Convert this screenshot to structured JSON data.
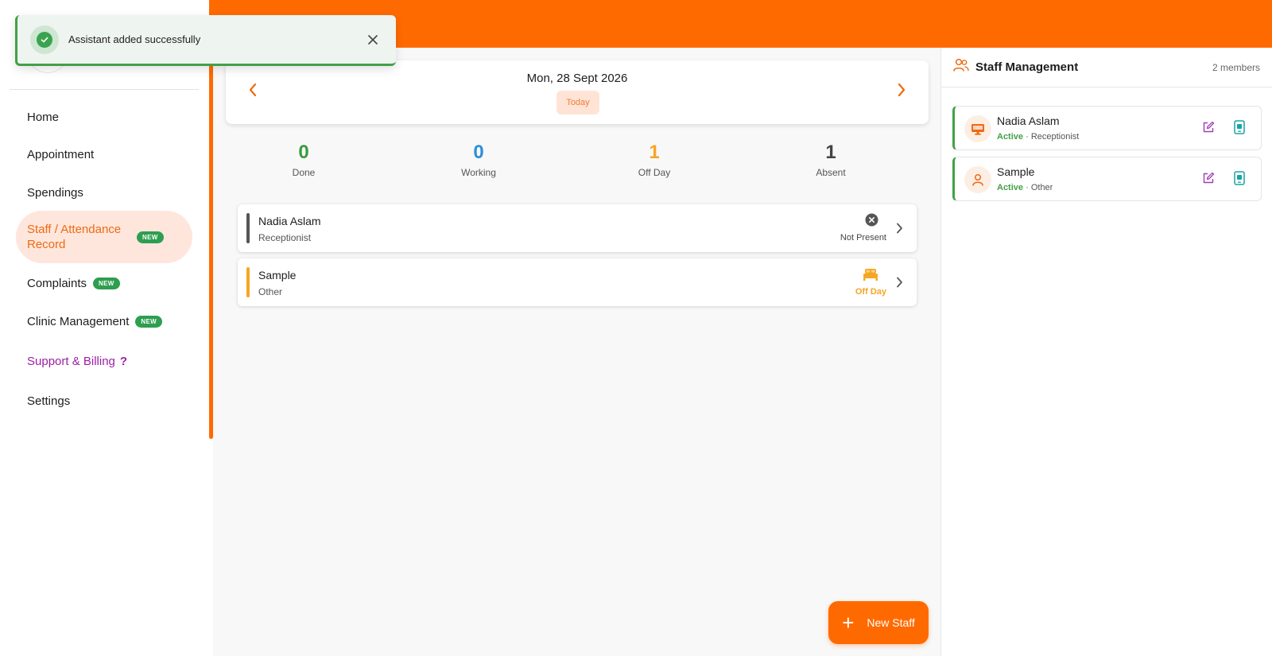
{
  "toast": {
    "message": "Assistant added successfully"
  },
  "sidebar": {
    "items": [
      {
        "label": "Home"
      },
      {
        "label": "Appointment"
      },
      {
        "label": "Spendings"
      },
      {
        "label": "Staff / Attendance Record",
        "badge": "NEW"
      },
      {
        "label": "Complaints",
        "badge": "NEW"
      },
      {
        "label": "Clinic Management",
        "badge": "NEW"
      },
      {
        "label": "Support & Billing",
        "suffix": "?"
      },
      {
        "label": "Settings"
      }
    ]
  },
  "date_card": {
    "date": "Mon, 28 Sept 2026",
    "today_label": "Today"
  },
  "stats": [
    {
      "value": "0",
      "label": "Done",
      "color": "#3a9a3e"
    },
    {
      "value": "0",
      "label": "Working",
      "color": "#2c8fd6"
    },
    {
      "value": "1",
      "label": "Off Day",
      "color": "#f5a623"
    },
    {
      "value": "1",
      "label": "Absent",
      "color": "#444444"
    }
  ],
  "attendance": [
    {
      "name": "Nadia Aslam",
      "role": "Receptionist",
      "status": "Not Present",
      "status_icon": "x-circle-icon",
      "bar_color": "#555555",
      "status_color": "#444444"
    },
    {
      "name": "Sample",
      "role": "Other",
      "status": "Off Day",
      "status_icon": "bed-icon",
      "bar_color": "#f5a623",
      "status_color": "#f5a623"
    }
  ],
  "fab": {
    "label": "New Staff"
  },
  "staff_panel": {
    "title": "Staff Management",
    "count": "2 members",
    "members": [
      {
        "name": "Nadia Aslam",
        "status": "Active",
        "role": "Receptionist",
        "avatar_icon": "monitor-icon"
      },
      {
        "name": "Sample",
        "status": "Active",
        "role": "Other",
        "avatar_icon": "user-icon"
      }
    ]
  },
  "colors": {
    "brand": "#ff6a00",
    "active_bg": "#ffe6dc",
    "success": "#43a047"
  }
}
